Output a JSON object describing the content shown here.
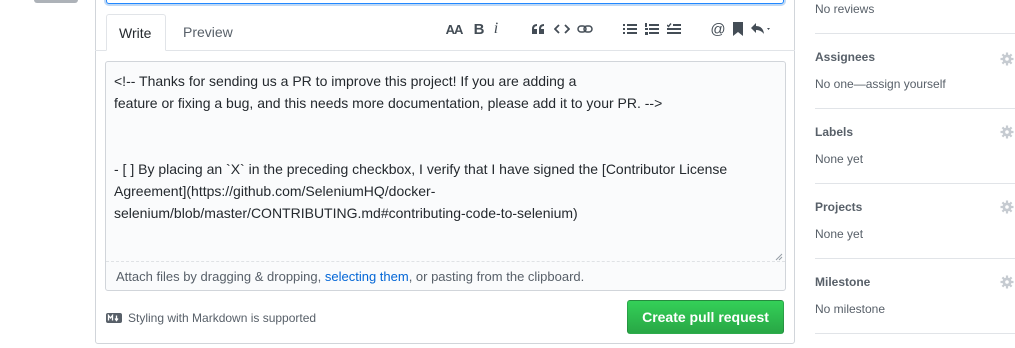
{
  "editor": {
    "tabs": {
      "write": "Write",
      "preview": "Preview"
    },
    "text": "<!-- Thanks for sending us a PR to improve this project! If you are adding a\nfeature or fixing a bug, and this needs more documentation, please add it to your PR. -->\n\n\n- [ ] By placing an `X` in the preceding checkbox, I verify that I have signed the [Contributor License Agreement](https://github.com/SeleniumHQ/docker-selenium/blob/master/CONTRIBUTING.md#contributing-code-to-selenium)",
    "drop_hint_prefix": "Attach files by dragging & dropping, ",
    "drop_hint_link": "selecting them",
    "drop_hint_suffix": ", or pasting from the clipboard.",
    "toolbar_icons": [
      "text-size-icon",
      "bold-icon",
      "italic-icon",
      "quote-icon",
      "code-icon",
      "link-icon",
      "unordered-list-icon",
      "ordered-list-icon",
      "task-list-icon",
      "mention-icon",
      "reference-icon",
      "reply-icon"
    ],
    "toolbar_glyphs": {
      "text_size": "AA",
      "bold": "B",
      "italic": "i",
      "mention": "@"
    }
  },
  "footer": {
    "markdown_note": "Styling with Markdown is supported",
    "create_button": "Create pull request"
  },
  "sidebar": {
    "reviewers_value": "No reviews",
    "assignees": {
      "heading": "Assignees",
      "value": "No one—assign yourself"
    },
    "labels": {
      "heading": "Labels",
      "value": "None yet"
    },
    "projects": {
      "heading": "Projects",
      "value": "None yet"
    },
    "milestone": {
      "heading": "Milestone",
      "value": "No milestone"
    }
  },
  "colors": {
    "primary_button": "#2ea44f",
    "link": "#0366d6",
    "focus": "#2188ff"
  }
}
